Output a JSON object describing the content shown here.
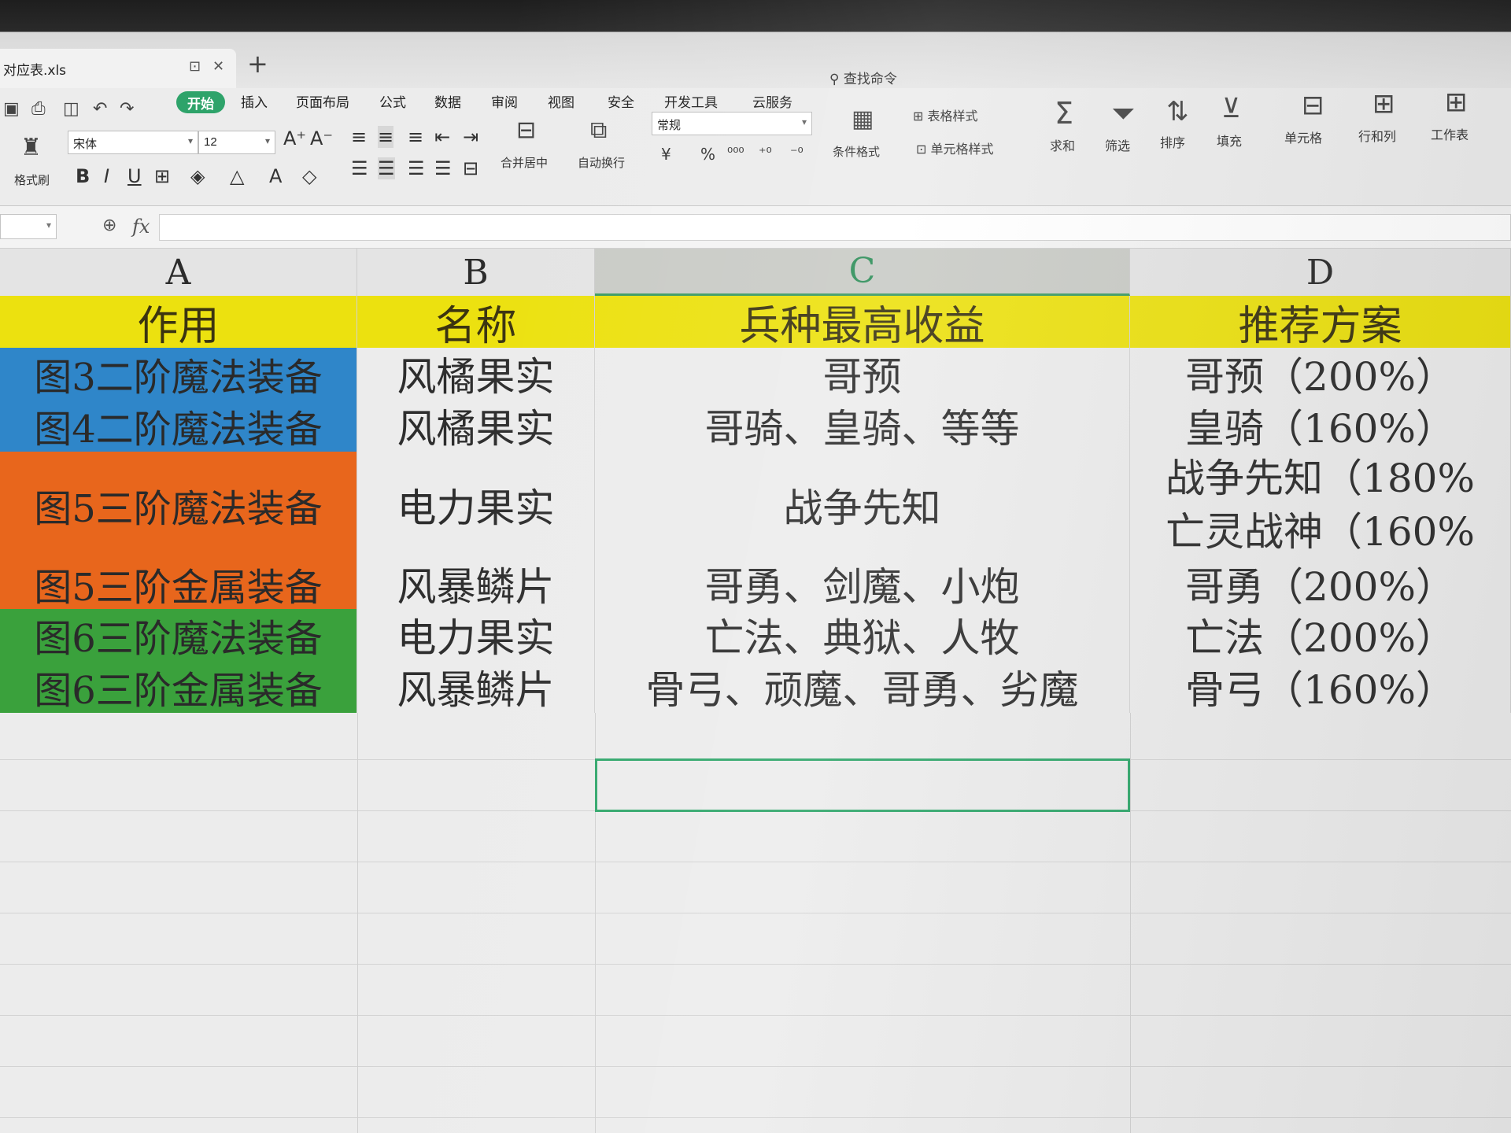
{
  "file_tab": {
    "name": "对应表.xls"
  },
  "menu": [
    "开始",
    "插入",
    "页面布局",
    "公式",
    "数据",
    "审阅",
    "视图",
    "安全",
    "开发工具",
    "云服务"
  ],
  "search_command": "查找命令",
  "ribbon": {
    "format_painter": "格式刷",
    "font_name": "宋体",
    "font_size": "12",
    "merge_center": "合并居中",
    "auto_wrap": "自动换行",
    "number_format": "常规",
    "currency": "¥",
    "percent": "%",
    "conditional_format": "条件格式",
    "table_style": "表格样式",
    "cell_style": "单元格样式",
    "sum": "求和",
    "filter": "筛选",
    "sort": "排序",
    "fill": "填充",
    "cell": "单元格",
    "row_col": "行和列",
    "worksheet": "工作表"
  },
  "formula_bar": {
    "fx": "fx",
    "value": ""
  },
  "columns": [
    "A",
    "B",
    "C",
    "D"
  ],
  "header_row": [
    "作用",
    "名称",
    "兵种最高收益",
    "推荐方案"
  ],
  "rows": [
    {
      "a": "图3二阶魔法装备",
      "b": "风橘果实",
      "c": "哥预",
      "d": [
        "哥预（200%）"
      ],
      "color": "#2f86c9"
    },
    {
      "a": "图4二阶魔法装备",
      "b": "风橘果实",
      "c": "哥骑、皇骑、等等",
      "d": [
        "皇骑（160%）"
      ],
      "color": "#2f86c9"
    },
    {
      "a": "图5三阶魔法装备",
      "b": "电力果实",
      "c": "战争先知",
      "d": [
        "战争先知（180%",
        "亡灵战神（160%"
      ],
      "color": "#e8661c"
    },
    {
      "a": "图5三阶金属装备",
      "b": "风暴鳞片",
      "c": "哥勇、剑魔、小炮",
      "d": [
        "哥勇（200%）"
      ],
      "color": "#e8661c"
    },
    {
      "a": "图6三阶魔法装备",
      "b": "电力果实",
      "c": "亡法、典狱、人牧",
      "d": [
        "亡法（200%）"
      ],
      "color": "#3aa13c"
    },
    {
      "a": "图6三阶金属装备",
      "b": "风暴鳞片",
      "c": "骨弓、顽魔、哥勇、劣魔",
      "d": [
        "骨弓（160%）"
      ],
      "color": "#3aa13c"
    }
  ]
}
